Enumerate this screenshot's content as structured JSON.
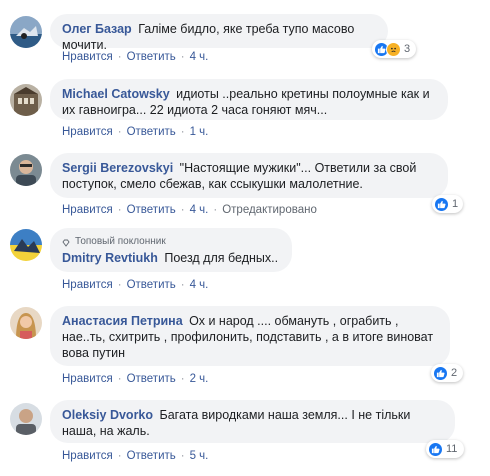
{
  "colors": {
    "author": "#385898",
    "bubble": "#f2f3f5",
    "muted": "#606770",
    "like": "#1877f2",
    "sad": "#f7b125"
  },
  "comments": [
    {
      "author": "Олег Базар",
      "text": "Галіме бидло, яке треба тупо масово мочити.",
      "actions": {
        "like": "Нравится",
        "reply": "Ответить",
        "time": "4 ч."
      },
      "reactions": {
        "icons": [
          "like-icon",
          "sad-icon"
        ],
        "count": "3"
      }
    },
    {
      "author": "Michael Catowsky",
      "text": "идиоты ..реально кретины полоумные как и их гавноигра... 22 идиота 2 часа гоняют мяч...",
      "actions": {
        "like": "Нравится",
        "reply": "Ответить",
        "time": "1 ч."
      }
    },
    {
      "author": "Sergii Berezovskyi",
      "text": "\"Настоящие мужики\"... Ответили за свой поступок, смело сбежав, как ссыкушки малолетние.",
      "actions": {
        "like": "Нравится",
        "reply": "Ответить",
        "time": "4 ч.",
        "edited": "Отредактировано"
      },
      "reactions": {
        "icons": [
          "like-icon"
        ],
        "count": "1"
      }
    },
    {
      "badge": "Топовый поклонник",
      "author": "Dmitry Revtiukh",
      "text": "Поезд для бедных..",
      "actions": {
        "like": "Нравится",
        "reply": "Ответить",
        "time": "4 ч."
      }
    },
    {
      "author": "Анастасия Петрина",
      "text": "Ох и народ .... обмануть , ограбить , нае..ть, схитрить , профилонить, подставить , а в итоге виноват вова путин",
      "actions": {
        "like": "Нравится",
        "reply": "Ответить",
        "time": "2 ч."
      },
      "reactions": {
        "icons": [
          "like-icon"
        ],
        "count": "2"
      }
    },
    {
      "author": "Oleksiy Dvorko",
      "text": "Багата виродками наша земля... І не тільки наша, на жаль.",
      "actions": {
        "like": "Нравится",
        "reply": "Ответить",
        "time": "5 ч."
      },
      "reactions": {
        "icons": [
          "like-icon"
        ],
        "count": "11"
      }
    }
  ]
}
